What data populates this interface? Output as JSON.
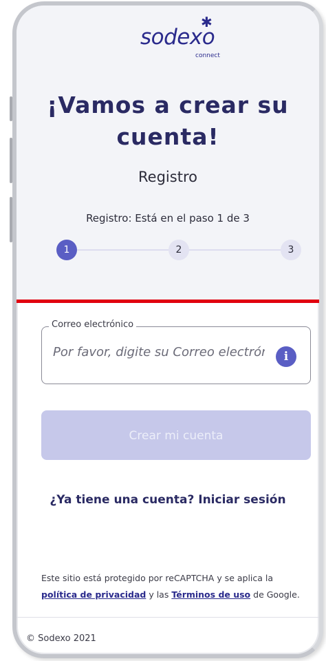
{
  "brand": {
    "logo_text": "sodexo",
    "logo_sub": "connect",
    "color": "#2a2a8c"
  },
  "header": {
    "title": "¡Vamos a crear su cuenta!",
    "subtitle": "Registro",
    "step_text": "Registro: Está en el paso 1 de 3"
  },
  "stepper": {
    "current": 1,
    "total": 3,
    "steps": [
      "1",
      "2",
      "3"
    ],
    "active_color": "#5a5ec4"
  },
  "form": {
    "email_label": "Correo electrónico",
    "email_placeholder": "Por favor, digite su Correo electrónico",
    "email_value": "",
    "info_icon": "info-icon",
    "submit_label": "Crear mi cuenta",
    "submit_disabled": true
  },
  "login": {
    "prompt": "¿Ya tiene una cuenta?",
    "link_label": "Iniciar sesión"
  },
  "legal": {
    "text_before": "Este sitio está protegido por reCAPTCHA y se aplica la",
    "privacy_link": "política de privacidad",
    "text_middle": "y las",
    "terms_link": "Términos de uso",
    "text_after": "de Google."
  },
  "footer": {
    "copyright": "© Sodexo 2021"
  },
  "colors": {
    "accent": "#e1000f",
    "primary": "#2a2a63",
    "button_disabled": "#c6c8ea"
  }
}
